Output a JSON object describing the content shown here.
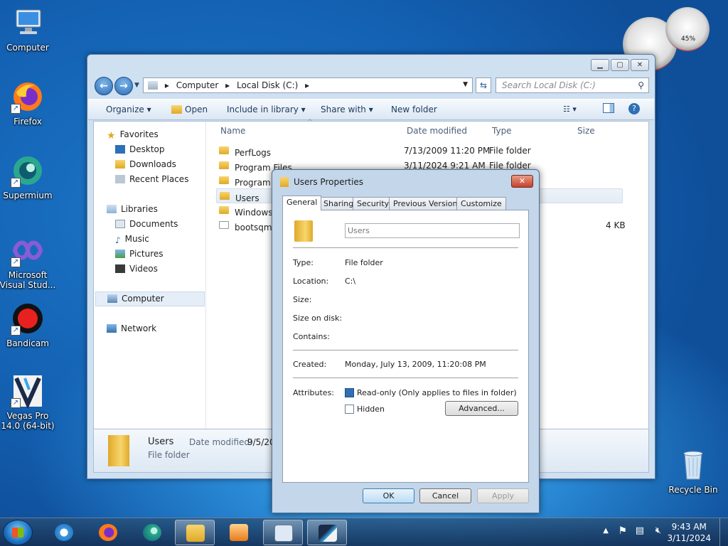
{
  "desktop": {
    "icons": [
      {
        "label": "Computer",
        "icon": "computer-icon"
      },
      {
        "label": "Firefox",
        "icon": "firefox-icon"
      },
      {
        "label": "Supermium",
        "icon": "supermium-icon"
      },
      {
        "label": "Microsoft Visual Stud...",
        "icon": "visual-studio-icon"
      },
      {
        "label": "Bandicam",
        "icon": "bandicam-icon"
      },
      {
        "label": "Vegas Pro 14.0 (64-bit)",
        "icon": "vegas-pro-icon"
      },
      {
        "label": "Recycle Bin",
        "icon": "recycle-bin-icon"
      }
    ],
    "gadget_cpu_label": "45%"
  },
  "explorer": {
    "breadcrumb": [
      "Computer",
      "Local Disk (C:)"
    ],
    "search_placeholder": "Search Local Disk (C:)",
    "toolbar": {
      "organize": "Organize",
      "open": "Open",
      "include_in_library": "Include in library",
      "share_with": "Share with",
      "new_folder": "New folder"
    },
    "nav": {
      "favorites": "Favorites",
      "desktop": "Desktop",
      "downloads": "Downloads",
      "recent_places": "Recent Places",
      "libraries": "Libraries",
      "documents": "Documents",
      "music": "Music",
      "pictures": "Pictures",
      "videos": "Videos",
      "computer": "Computer",
      "network": "Network"
    },
    "columns": {
      "name": "Name",
      "date": "Date modified",
      "type": "Type",
      "size": "Size"
    },
    "files": [
      {
        "name": "PerfLogs",
        "date": "7/13/2009 11:20 PM",
        "type": "File folder",
        "size": ""
      },
      {
        "name": "Program Files",
        "date": "3/11/2024 9:21 AM",
        "type": "File folder",
        "size": ""
      },
      {
        "name": "Program F",
        "date": "",
        "type": "",
        "size": ""
      },
      {
        "name": "Users",
        "date": "",
        "type": "",
        "size": ""
      },
      {
        "name": "Windows",
        "date": "",
        "type": "",
        "size": ""
      },
      {
        "name": "bootsqm.d",
        "date": "",
        "type": "",
        "size": "4 KB"
      }
    ],
    "details": {
      "name": "Users",
      "date_label": "Date modified:",
      "date_value": "9/5/20",
      "type": "File folder"
    }
  },
  "dialog": {
    "title": "Users Properties",
    "tabs": [
      "General",
      "Sharing",
      "Security",
      "Previous Versions",
      "Customize"
    ],
    "name_value": "Users",
    "type_label": "Type:",
    "type_value": "File folder",
    "location_label": "Location:",
    "location_value": "C:\\",
    "size_label": "Size:",
    "size_on_disk_label": "Size on disk:",
    "contains_label": "Contains:",
    "created_label": "Created:",
    "created_value": "Monday, July 13, 2009, 11:20:08 PM",
    "attributes_label": "Attributes:",
    "readonly_label": "Read-only (Only applies to files in folder)",
    "hidden_label": "Hidden",
    "advanced_label": "Advanced...",
    "ok": "OK",
    "cancel": "Cancel",
    "apply": "Apply"
  },
  "taskbar": {
    "time": "9:43 AM",
    "date": "3/11/2024"
  }
}
